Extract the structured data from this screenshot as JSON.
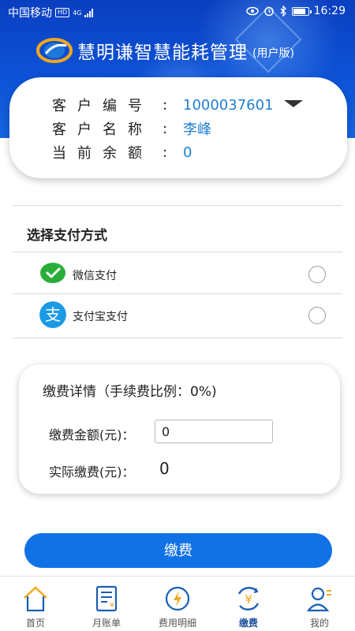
{
  "status_bar": {
    "carrier": "中国移动",
    "hd": "HD",
    "network": "4G",
    "time": "16:29"
  },
  "header": {
    "title": "慧明谦智慧能耗管理",
    "subtitle": "(用户版)"
  },
  "customer": {
    "id_label": "客户编号",
    "id_value": "1000037601",
    "name_label": "客户名称",
    "name_value": "李峰",
    "balance_label": "当前余额",
    "balance_value": "0",
    "colon": ":"
  },
  "payment_method": {
    "title": "选择支付方式",
    "options": [
      {
        "label": "微信支付",
        "icon": "wechat-icon",
        "color": "#2aae3a",
        "selected": false
      },
      {
        "label": "支付宝支付",
        "icon": "alipay-icon",
        "color": "#1a9ae4",
        "selected": false
      }
    ]
  },
  "details": {
    "title": "缴费详情（手续费比例：0%)",
    "amount_label": "缴费金额(元)：",
    "amount_value": "0",
    "actual_label": "实际缴费(元)：",
    "actual_value": "0"
  },
  "pay_button": "缴费",
  "nav": [
    {
      "label": "首页",
      "icon": "home-icon",
      "active": false
    },
    {
      "label": "月账单",
      "icon": "bill-icon",
      "active": false
    },
    {
      "label": "费用明细",
      "icon": "lightning-icon",
      "active": false
    },
    {
      "label": "缴费",
      "icon": "yuan-icon",
      "active": true
    },
    {
      "label": "我的",
      "icon": "user-icon",
      "active": false
    }
  ],
  "colors": {
    "header_blue": "#0d52d6",
    "accent_blue": "#1172e6",
    "link_blue": "#1f7fd1"
  }
}
